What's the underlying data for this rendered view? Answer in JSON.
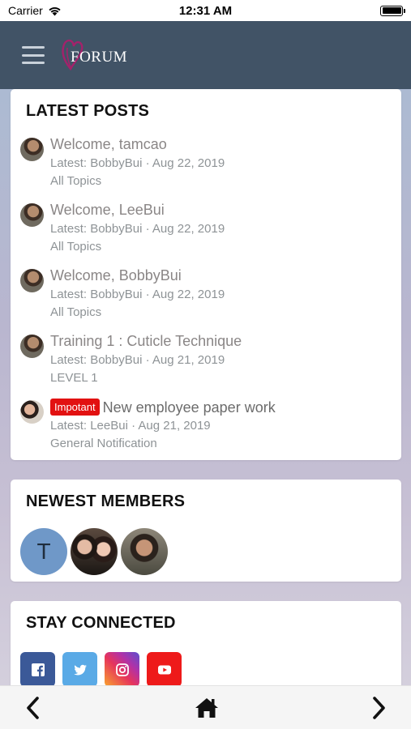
{
  "status_bar": {
    "carrier": "Carrier",
    "time": "12:31 AM"
  },
  "header": {
    "logo_text": "FORUM",
    "logo_accent_color": "#a3226b",
    "background_color": "#415366"
  },
  "latest_posts": {
    "title": "LATEST POSTS",
    "items": [
      {
        "title": "Welcome, tamcao",
        "meta": "Latest: BobbyBui · Aug 22, 2019",
        "category": "All Topics"
      },
      {
        "title": "Welcome, LeeBui",
        "meta": "Latest: BobbyBui · Aug 22, 2019",
        "category": "All Topics"
      },
      {
        "title": "Welcome, BobbyBui",
        "meta": "Latest: BobbyBui · Aug 22, 2019",
        "category": "All Topics"
      },
      {
        "title": "Training 1 : Cuticle Technique",
        "meta": "Latest: BobbyBui · Aug 21, 2019",
        "category": "LEVEL 1"
      },
      {
        "badge": "Impotant",
        "title": "New employee paper work",
        "meta": "Latest: LeeBui · Aug 21, 2019",
        "category": "General Notification"
      }
    ]
  },
  "newest_members": {
    "title": "NEWEST MEMBERS",
    "first_initial": "T"
  },
  "stay_connected": {
    "title": "STAY CONNECTED",
    "icons": [
      "facebook-icon",
      "twitter-icon",
      "instagram-icon",
      "youtube-icon"
    ]
  },
  "bottom_nav": {
    "icons": [
      "chevron-left-icon",
      "home-icon",
      "chevron-right-icon"
    ]
  },
  "colors": {
    "badge": "#e21111",
    "facebook": "#3b5998",
    "twitter": "#5aaae6",
    "youtube": "#ee1a1a"
  }
}
